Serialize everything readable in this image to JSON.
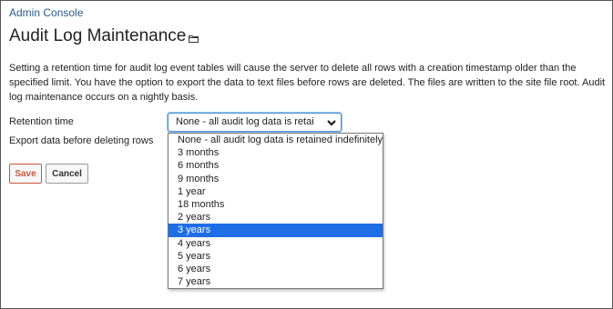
{
  "breadcrumb": {
    "label": "Admin Console"
  },
  "page": {
    "title": "Audit Log Maintenance",
    "description": "Setting a retention time for audit log event tables will cause the server to delete all rows with a creation timestamp older than the specified limit. You have the option to export the data to text files before rows are deleted. The files are written to the site file root. Audit log maintenance occurs on a nightly basis."
  },
  "form": {
    "retention_label": "Retention time",
    "export_label": "Export data before deleting rows",
    "retention_value": "None - all audit log data is retained indefinitely",
    "retention_options": [
      "None - all audit log data is retained indefinitely",
      "3 months",
      "6 months",
      "9 months",
      "1 year",
      "18 months",
      "2 years",
      "3 years",
      "4 years",
      "5 years",
      "6 years",
      "7 years"
    ],
    "highlighted_option": "3 years"
  },
  "buttons": {
    "save": "Save",
    "cancel": "Cancel"
  },
  "colors": {
    "link": "#2b5a8c",
    "highlight": "#1e6ee6",
    "save_accent": "#c9573a",
    "focus_border": "#4a90d9"
  },
  "icons": {
    "title_icon": "folder-icon",
    "select_icon": "chevron-down-icon"
  }
}
